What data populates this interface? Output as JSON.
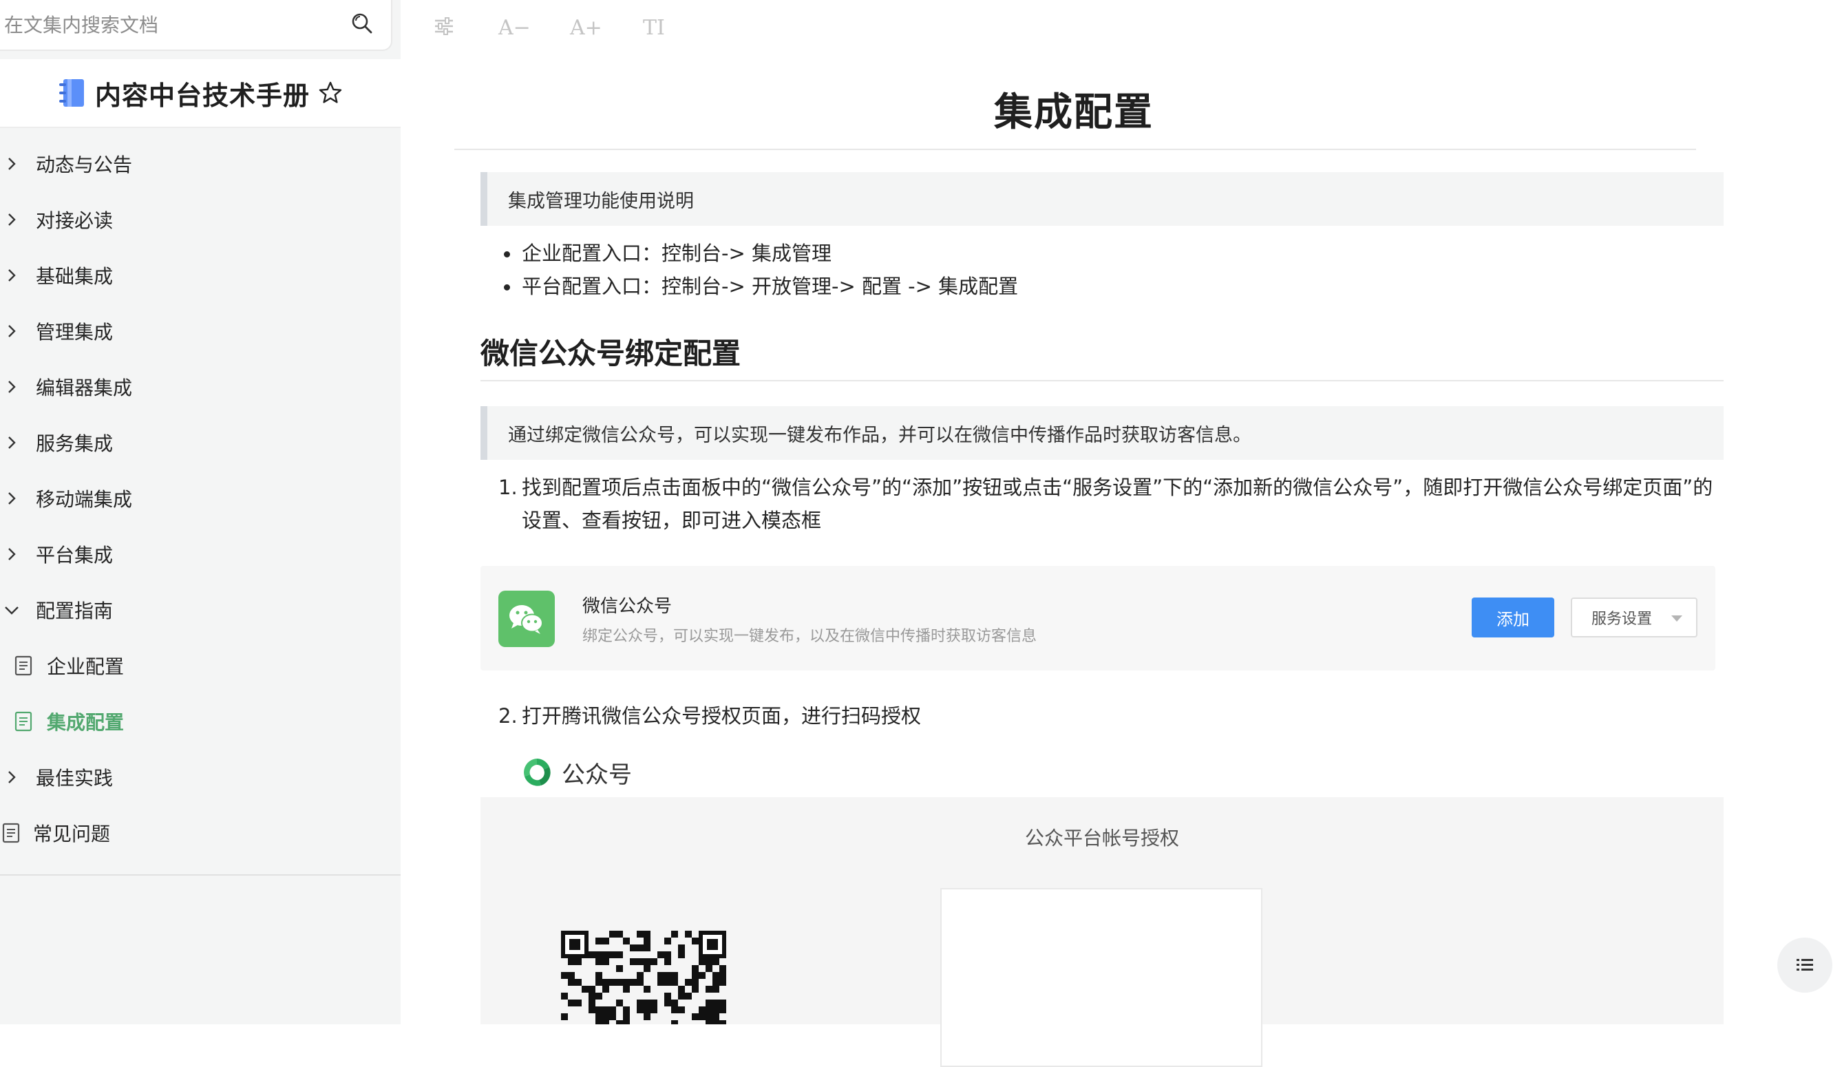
{
  "search": {
    "placeholder": "在文集内搜索文档"
  },
  "book": {
    "title": "内容中台技术手册"
  },
  "sidebar": {
    "items": [
      {
        "label": "动态与公告",
        "type": "folder",
        "expanded": false
      },
      {
        "label": "对接必读",
        "type": "folder",
        "expanded": false
      },
      {
        "label": "基础集成",
        "type": "folder",
        "expanded": false
      },
      {
        "label": "管理集成",
        "type": "folder",
        "expanded": false
      },
      {
        "label": "编辑器集成",
        "type": "folder",
        "expanded": false
      },
      {
        "label": "服务集成",
        "type": "folder",
        "expanded": false
      },
      {
        "label": "移动端集成",
        "type": "folder",
        "expanded": false
      },
      {
        "label": "平台集成",
        "type": "folder",
        "expanded": false
      },
      {
        "label": "配置指南",
        "type": "folder",
        "expanded": true
      },
      {
        "label": "企业配置",
        "type": "doc",
        "active": false
      },
      {
        "label": "集成配置",
        "type": "doc",
        "active": true
      },
      {
        "label": "最佳实践",
        "type": "folder",
        "expanded": false
      },
      {
        "label": "常见问题",
        "type": "doc",
        "active": false
      }
    ]
  },
  "toolbar": {
    "font_decrease": "A−",
    "font_increase": "A+",
    "font_toggle": "TI"
  },
  "article": {
    "title": "集成配置",
    "intro_note": "集成管理功能使用说明",
    "bullets": [
      "企业配置入口：控制台-> 集成管理",
      "平台配置入口：控制台-> 开放管理-> 配置 -> 集成配置"
    ],
    "section_title": "微信公众号绑定配置",
    "section_note": "通过绑定微信公众号，可以实现一键发布作品，并可以在微信中传播作品时获取访客信息。",
    "step1_num": "1.",
    "step1_line1": "找到配置项后点击面板中的“微信公众号”的“添加”按钮或点击“服务设置”下的“添加新的微信公众号”，随即打开微信公众号绑定页面”的",
    "step1_line2": "设置、查看按钮，即可进入模态框",
    "step2_num": "2.",
    "step2_text": "打开腾讯微信公众号授权页面，进行扫码授权"
  },
  "wechat_card": {
    "name": "微信公众号",
    "desc": "绑定公众号，可以实现一键发布，以及在微信中传播时获取访客信息",
    "add_label": "添加",
    "service_label": "服务设置"
  },
  "auth": {
    "brand": "公众号",
    "title": "公众平台帐号授权"
  },
  "colors": {
    "accent": "#52a86f",
    "primary_button": "#3e8ef4",
    "wechat_green": "#5fc16a"
  }
}
